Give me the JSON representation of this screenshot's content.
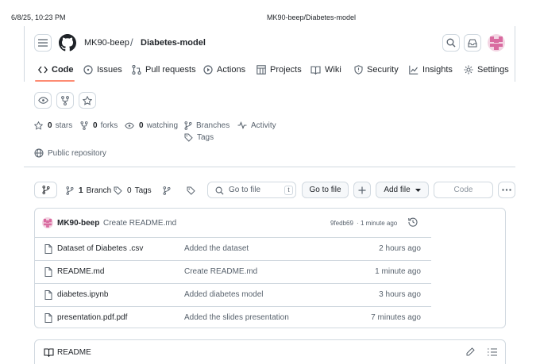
{
  "print_header": {
    "datetime": "6/8/25, 10:23 PM",
    "page_title": "MK90-beep/Diabetes-model"
  },
  "header": {
    "owner": "MK90-beep",
    "separator": "/",
    "repo": "Diabetes-model"
  },
  "nav": {
    "code": "Code",
    "issues": "Issues",
    "pull_requests": "Pull requests",
    "actions": "Actions",
    "projects": "Projects",
    "wiki": "Wiki",
    "security": "Security",
    "insights": "Insights",
    "settings": "Settings"
  },
  "stats": {
    "stars_count": "0",
    "stars_label": "stars",
    "forks_count": "0",
    "forks_label": "forks",
    "watching_count": "0",
    "watching_label": "watching",
    "branches": "Branches",
    "activity": "Activity",
    "tags": "Tags",
    "visibility": "Public repository"
  },
  "toolbar": {
    "branch_count": "1",
    "branch_label": "Branch",
    "tag_count": "0",
    "tag_label": "Tags",
    "search_placeholder": "Go to file",
    "search_shortcut": "t",
    "go_to_file": "Go to file",
    "add_file": "Add file",
    "code": "Code"
  },
  "commit": {
    "author": "MK90-beep",
    "message": "Create README.md",
    "hash": "9fedb69",
    "dot": "·",
    "time": "1 minute ago"
  },
  "files": [
    {
      "name": "Dataset of Diabetes .csv",
      "message": "Added the dataset",
      "time": "2 hours ago"
    },
    {
      "name": "README.md",
      "message": "Create README.md",
      "time": "1 minute ago"
    },
    {
      "name": "diabetes.ipynb",
      "message": "Added diabetes model",
      "time": "3 hours ago"
    },
    {
      "name": "presentation.pdf.pdf",
      "message": "Added the slides presentation",
      "time": "7 minutes ago"
    }
  ],
  "readme": {
    "title": "README"
  },
  "colors": {
    "avatar": "#d96ba0",
    "border": "#d1d9e0",
    "active_tab": "#fd8c73"
  }
}
